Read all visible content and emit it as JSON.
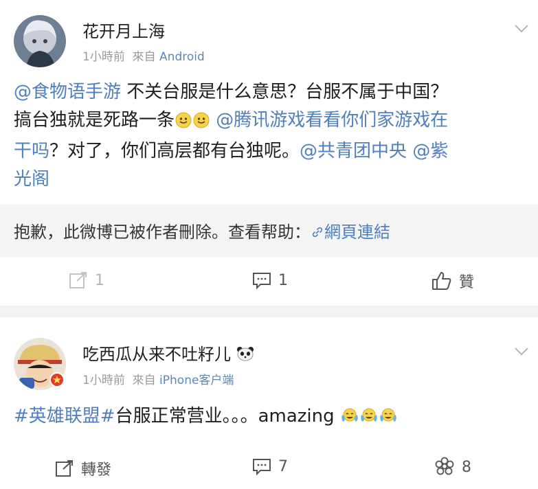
{
  "post1": {
    "username": "花开月上海",
    "time": "1小時前",
    "source_prefix": "來自",
    "source": "Android",
    "mention1": "@食物语手游",
    "text1": " 不关台服是什么意思？台服不属于中国？",
    "text2": "搞台独就是死路一条",
    "mention2": "@腾讯游戏看看你们家游戏在",
    "mention2b": "干吗",
    "text3": "？对了，你们高层都有台独呢。",
    "mention3": "@共青团中央",
    "mention4": "@紫",
    "mention4b": "光阁",
    "deleted_notice": "抱歉，此微博已被作者刪除。查看帮助：",
    "deleted_link": "網頁連結",
    "actions": {
      "repost_count": "1",
      "comment_count": "1",
      "like_label": "贊"
    }
  },
  "post2": {
    "username": "吃西瓜从来不吐籽儿",
    "time": "1小時前",
    "source_prefix": "來自",
    "source": "iPhone客户端",
    "hashtag": "#英雄联盟#",
    "text": "台服正常营业。。。amazing",
    "actions": {
      "repost_label": "轉發",
      "comment_count": "7",
      "like_count": "8"
    }
  },
  "colors": {
    "link": "#4e7fc0",
    "meta": "#9a9a9a",
    "separator": "#f2f2f2"
  }
}
